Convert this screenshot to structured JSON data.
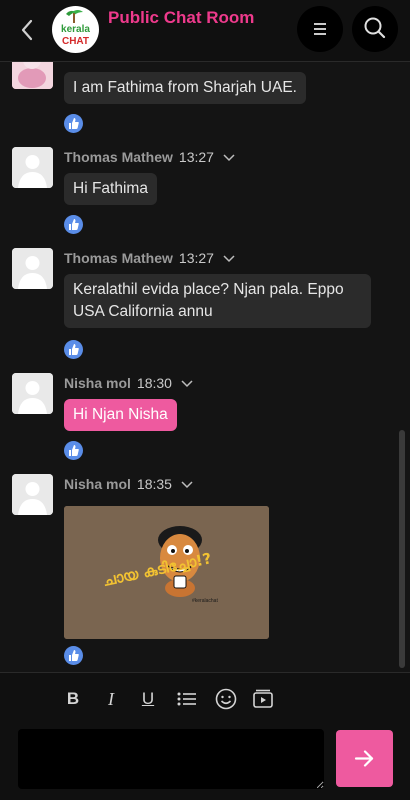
{
  "header": {
    "title": "Public Chat Room",
    "logo_text_top": "kerala",
    "logo_text_bottom": "CHAT"
  },
  "messages": [
    {
      "type": "text",
      "text": "I am Fathima from Sharjah UAE.",
      "style": "dark"
    },
    {
      "type": "text",
      "author": "Thomas Mathew",
      "time": "13:27",
      "text": "Hi Fathima",
      "style": "dark"
    },
    {
      "type": "text",
      "author": "Thomas Mathew",
      "time": "13:27",
      "text": "Keralathil evida place? Njan pala. Eppo USA California annu",
      "style": "dark"
    },
    {
      "type": "text",
      "author": "Nisha mol",
      "time": "18:30",
      "text": "Hi Njan Nisha",
      "style": "pink"
    },
    {
      "type": "image",
      "author": "Nisha mol",
      "time": "18:35",
      "image_caption": "ചായ കുടിച്ചോ!?",
      "image_credit": "#keralachat"
    }
  ],
  "composer": {
    "bold_label": "B",
    "italic_label": "I",
    "underline_label": "U",
    "icons": [
      "bold-icon",
      "italic-icon",
      "underline-icon",
      "list-icon",
      "emoji-icon",
      "media-icon",
      "send-arrow-icon"
    ],
    "input_value": ""
  },
  "colors": {
    "accent": "#ee3a8c",
    "bubble_pink": "#ee5a9f",
    "bubble_dark": "#2b2b2b",
    "like_blue": "#5a8de8",
    "background": "#141414"
  }
}
